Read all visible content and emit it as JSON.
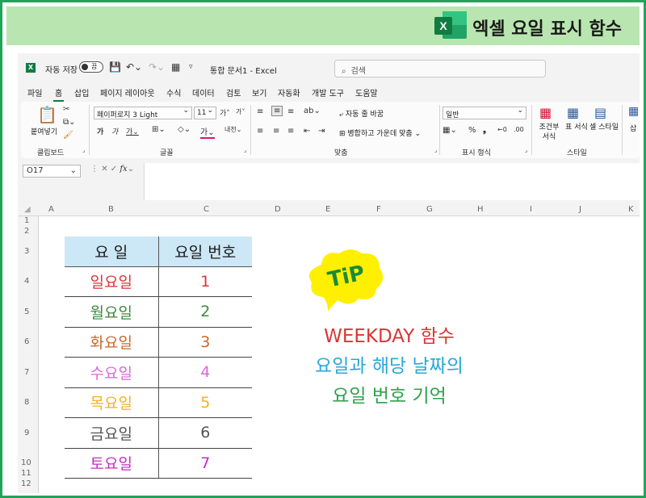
{
  "banner": {
    "title": "엑셀 요일 표시 함수",
    "logo_letter": "X"
  },
  "titlebar": {
    "app_icon_letter": "X",
    "autosave_label": "자동 저장",
    "autosave_state": "끔",
    "document_title": "통합 문서1  -  Excel",
    "search_placeholder": "검색"
  },
  "menu": [
    "파일",
    "홈",
    "삽입",
    "페이지 레이아웃",
    "수식",
    "데이터",
    "검토",
    "보기",
    "자동화",
    "개발 도구",
    "도움말"
  ],
  "ribbon": {
    "clipboard": {
      "paste_label": "붙여넣기",
      "group_label": "클립보드"
    },
    "font": {
      "font_name": "페이퍼로지 3 Light",
      "font_size": "11",
      "group_label": "글꼴"
    },
    "alignment": {
      "wrap_text": "자동 줄 바꿈",
      "merge_center": "병합하고 가운데 맞춤",
      "group_label": "맞춤"
    },
    "number": {
      "format": "일반",
      "group_label": "표시 형식"
    },
    "styles": {
      "conditional": "조건부 서식",
      "table": "표 서식",
      "cell": "셀 스타일",
      "group_label": "스타일"
    },
    "insert_partial": "삽"
  },
  "formula_bar": {
    "name_box": "O17",
    "fx": "fx"
  },
  "columns": [
    "A",
    "B",
    "C",
    "D",
    "E",
    "F",
    "G",
    "H",
    "I",
    "J",
    "K"
  ],
  "rows": [
    "1",
    "2",
    "3",
    "4",
    "5",
    "6",
    "7",
    "8",
    "9",
    "10",
    "11",
    "12"
  ],
  "table": {
    "headers": [
      "요 일",
      "요일 번호"
    ],
    "rows": [
      {
        "day": "일요일",
        "num": "1"
      },
      {
        "day": "월요일",
        "num": "2"
      },
      {
        "day": "화요일",
        "num": "3"
      },
      {
        "day": "수요일",
        "num": "4"
      },
      {
        "day": "목요일",
        "num": "5"
      },
      {
        "day": "금요일",
        "num": "6"
      },
      {
        "day": "토요일",
        "num": "7"
      }
    ],
    "row_colors": [
      "#d93636",
      "#3b8a3b",
      "#c8692d",
      "#d86ad8",
      "#f2b31f",
      "#555555",
      "#c32ec3"
    ]
  },
  "tip": {
    "label": "TiP",
    "bubble_color": "#ffef00"
  },
  "notes": [
    {
      "text": "WEEKDAY 함수",
      "color": "#d93636"
    },
    {
      "text": "요일과 해당 날짜의",
      "color": "#29a8d8"
    },
    {
      "text": "요일 번호 기억",
      "color": "#2ea24a"
    }
  ],
  "colors": {
    "frame": "#22a35a",
    "banner": "#b9e6b0",
    "excel_green": "#107c41",
    "header_fill": "#cce8f6"
  }
}
